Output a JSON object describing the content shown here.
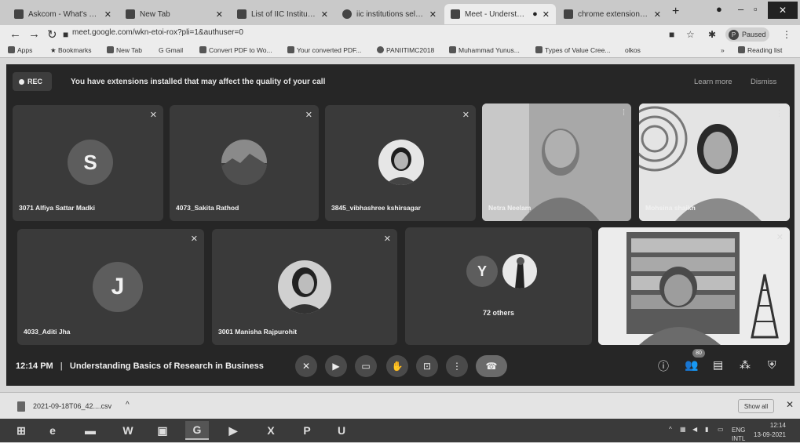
{
  "browser": {
    "tabs": [
      {
        "label": "Askcom - What's Your",
        "active": false
      },
      {
        "label": "New Tab",
        "active": false
      },
      {
        "label": "List of IIC Institutions",
        "active": false
      },
      {
        "label": "iic institutions selected",
        "active": false
      },
      {
        "label": "Meet - Understanding",
        "active": true
      },
      {
        "label": "chrome extension//ac",
        "active": false
      }
    ],
    "url": "meet.google.com/wkn-etoi-rox?pli=1&authuser=0",
    "profile_label": "Paused",
    "bookmarks": [
      "Apps",
      "Bookmarks",
      "New Tab",
      "Gmail",
      "Convert PDF to Wo...",
      "Your converted PDF...",
      "PANIITIMC2018",
      "Muhammad Yunus...",
      "Types of Value Cree...",
      "olkos",
      "Reading list"
    ]
  },
  "meet": {
    "rec_label": "REC",
    "banner": "You have extensions installed that may affect the quality of your call",
    "learn_more": "Learn more",
    "dismiss": "Dismiss",
    "participants": [
      {
        "name": "3071 Alfiya Sattar Madki",
        "avatar_letter": "S",
        "muted": true
      },
      {
        "name": "4073_Sakita Rathod",
        "avatar_letter": "",
        "muted": true
      },
      {
        "name": "3845_vibhashree kshirsagar",
        "avatar_letter": "",
        "muted": true
      },
      {
        "name": "Netra Neelam",
        "avatar_letter": "",
        "muted": false
      },
      {
        "name": "Mohsina shaikh",
        "avatar_letter": "",
        "muted": false
      },
      {
        "name": "4033_Aditi Jha",
        "avatar_letter": "J",
        "muted": true
      },
      {
        "name": "3001 Manisha Rajpurohit",
        "avatar_letter": "",
        "muted": true
      }
    ],
    "others": {
      "avatar_letter": "Y",
      "label": "72 others"
    },
    "time": "12:14 PM",
    "separator": "|",
    "meeting_title": "Understanding Basics of Research in Business",
    "people_count": "80"
  },
  "download": {
    "filename": "2021-09-18T06_42....csv",
    "show_all": "Show all"
  },
  "taskbar": {
    "lang": "ENG",
    "lang_sub": "INTL",
    "time": "12:14",
    "date": "13-09-2021"
  }
}
